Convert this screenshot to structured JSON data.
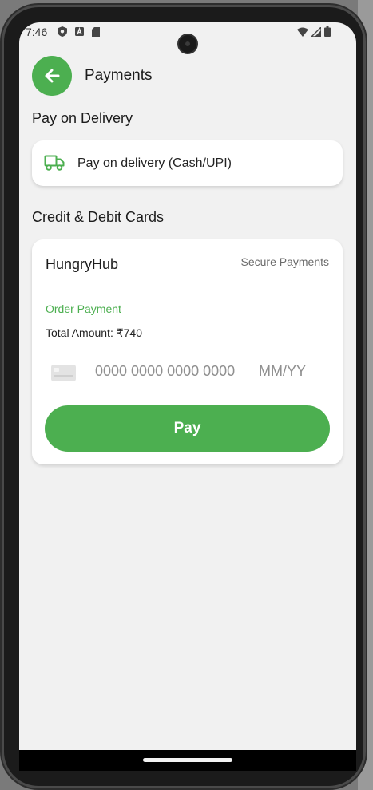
{
  "status_bar": {
    "time": "7:46",
    "left_icons": [
      "shield-icon",
      "a-badge-icon",
      "sd-card-icon"
    ],
    "right_icons": [
      "wifi-icon",
      "cell-signal-icon",
      "battery-icon"
    ]
  },
  "header": {
    "back_icon": "arrow-left-icon",
    "title": "Payments"
  },
  "pay_on_delivery": {
    "section_title": "Pay on Delivery",
    "icon": "truck-icon",
    "option_label": "Pay on delivery (Cash/UPI)"
  },
  "cards": {
    "section_title": "Credit & Debit Cards",
    "merchant": "HungryHub",
    "secure_label": "Secure Payments",
    "order_label": "Order Payment",
    "total_amount": "Total Amount: ₹740",
    "card_icon": "credit-card-icon",
    "card_number_placeholder": "0000 0000 0000 0000",
    "expiry_placeholder": "MM/YY",
    "pay_button_label": "Pay"
  },
  "colors": {
    "accent": "#4caf50",
    "background": "#f1f1f1",
    "card": "#ffffff"
  }
}
